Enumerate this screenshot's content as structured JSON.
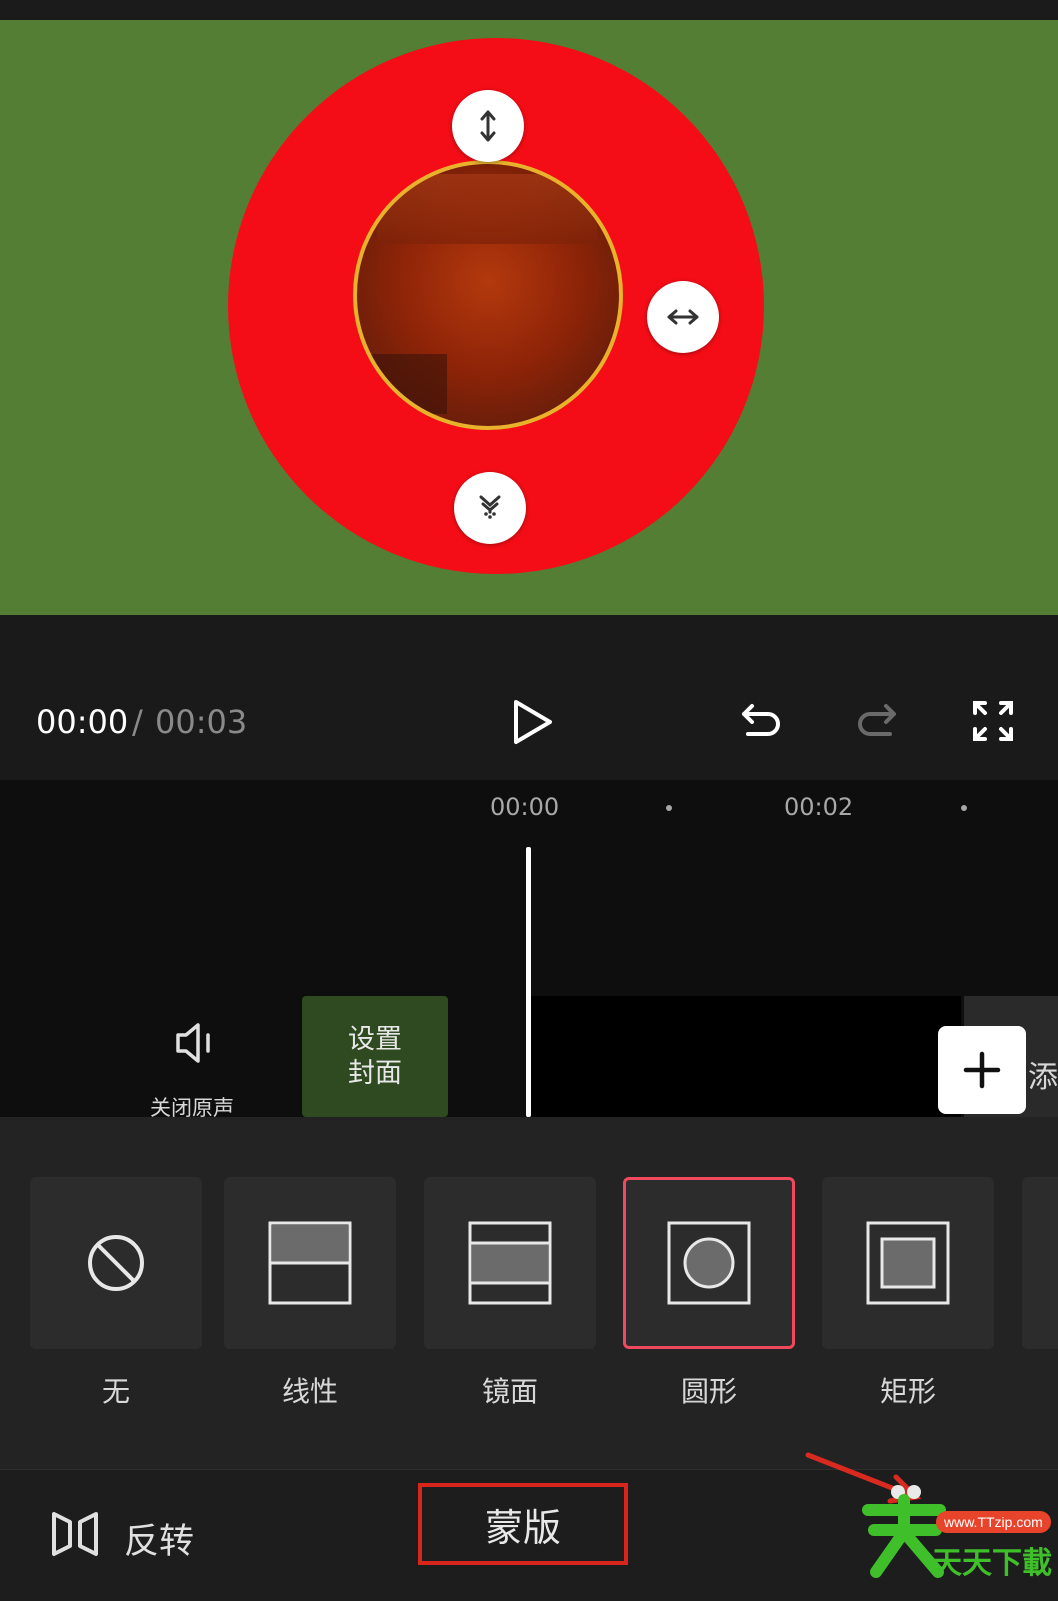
{
  "playback": {
    "current_time": "00:00",
    "separator": "/",
    "total_time": "00:03"
  },
  "timeline": {
    "ruler_labels": [
      "00:00",
      "00:02"
    ],
    "mute_label": "关闭原声",
    "cover_label_line1": "设置",
    "cover_label_line2": "封面",
    "add_label": "添"
  },
  "masks": {
    "items": [
      {
        "label": "无",
        "icon": "none-icon"
      },
      {
        "label": "线性",
        "icon": "linear-mask-icon"
      },
      {
        "label": "镜面",
        "icon": "mirror-mask-icon"
      },
      {
        "label": "圆形",
        "icon": "circle-mask-icon",
        "selected": true
      },
      {
        "label": "矩形",
        "icon": "rectangle-mask-icon"
      }
    ]
  },
  "toolbar": {
    "flip_label": "反转",
    "mask_tab_label": "蒙版"
  },
  "watermark": {
    "site": "www.TTzip.com",
    "brand": "天天下載"
  },
  "colors": {
    "preview_bg": "#537e34",
    "mask_ring": "#f40d16",
    "selected_border": "#f0495e",
    "highlight_box": "#d9261c"
  }
}
